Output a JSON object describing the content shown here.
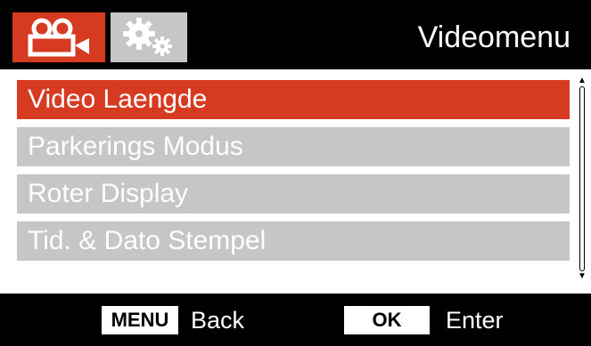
{
  "header": {
    "title": "Videomenu",
    "tabs": [
      {
        "icon": "video-camera-icon",
        "active": true
      },
      {
        "icon": "gears-icon",
        "active": false
      }
    ]
  },
  "menu": {
    "items": [
      {
        "label": "Video Laengde",
        "selected": true
      },
      {
        "label": "Parkerings Modus",
        "selected": false
      },
      {
        "label": "Roter Display",
        "selected": false
      },
      {
        "label": "Tid. & Dato Stempel",
        "selected": false
      }
    ]
  },
  "footer": {
    "menu_key": "MENU",
    "menu_action": "Back",
    "ok_key": "OK",
    "ok_action": "Enter"
  },
  "colors": {
    "accent": "#d63a20",
    "inactive": "#c6c6c6",
    "background": "#000000",
    "content_bg": "#ffffff"
  }
}
